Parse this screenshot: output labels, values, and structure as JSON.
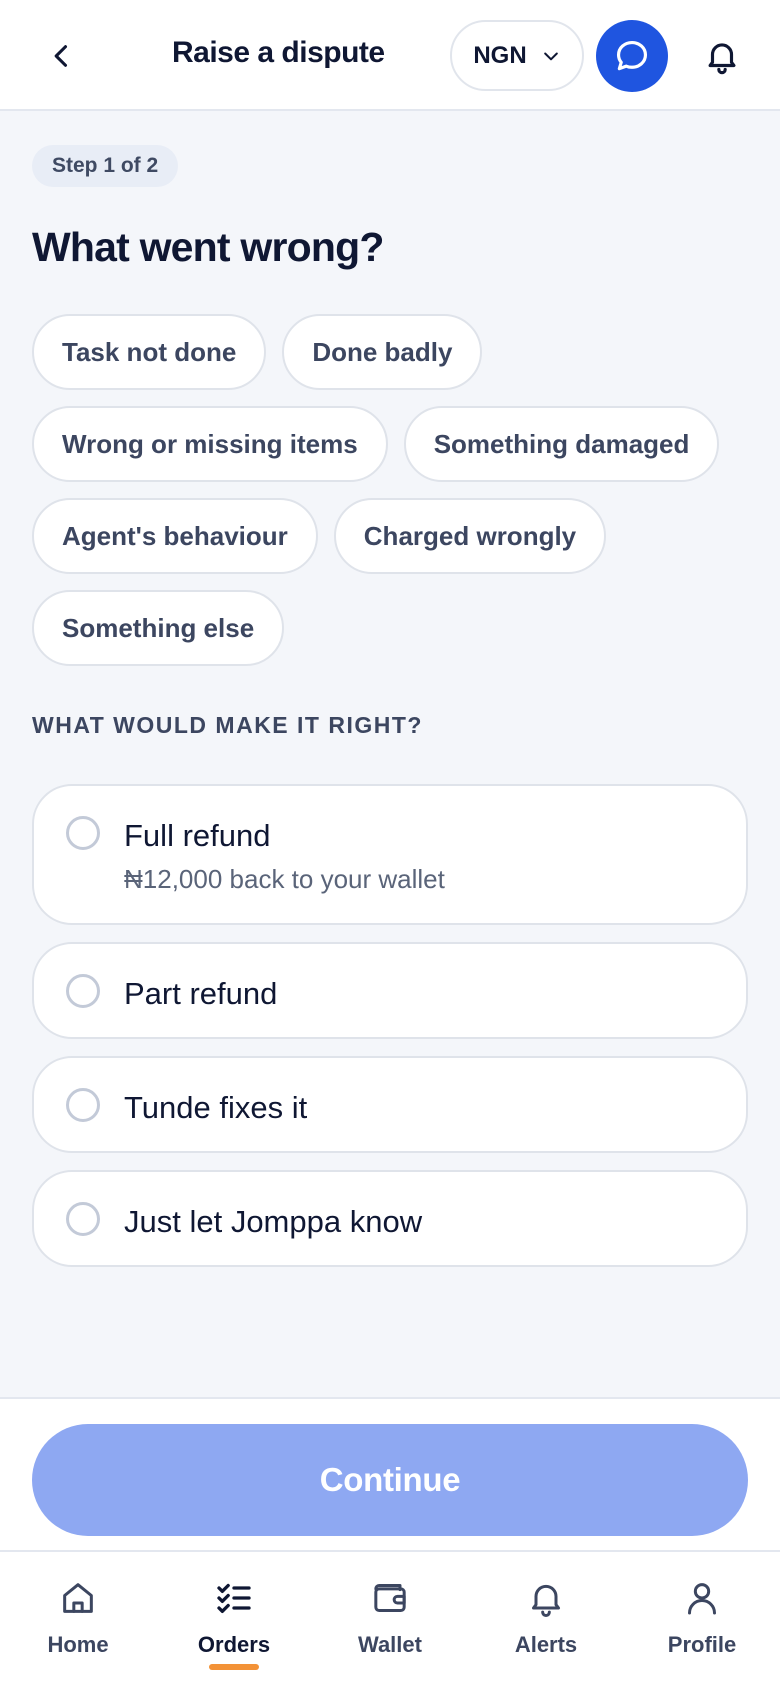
{
  "header": {
    "title": "Raise a dispute",
    "currency": "NGN"
  },
  "step": "Step 1 of 2",
  "question": "What went wrong?",
  "issues": [
    "Task not done",
    "Done badly",
    "Wrong or missing items",
    "Something damaged",
    "Agent's behaviour",
    "Charged wrongly",
    "Something else"
  ],
  "resolution_label": "WHAT WOULD MAKE IT RIGHT?",
  "options": [
    {
      "title": "Full refund",
      "subtitle": "₦12,000 back to your wallet"
    },
    {
      "title": "Part refund"
    },
    {
      "title": "Tunde fixes it"
    },
    {
      "title": "Just let Jomppa know"
    }
  ],
  "cta": {
    "label": "Continue"
  },
  "nav": [
    {
      "label": "Home",
      "icon": "home-icon"
    },
    {
      "label": "Orders",
      "icon": "orders-icon",
      "active": true
    },
    {
      "label": "Wallet",
      "icon": "wallet-icon"
    },
    {
      "label": "Alerts",
      "icon": "bell-icon"
    },
    {
      "label": "Profile",
      "icon": "profile-icon"
    }
  ],
  "colors": {
    "accent": "#1f55e0",
    "cta_disabled": "#8ea8f2",
    "active_indicator": "#f39237"
  }
}
